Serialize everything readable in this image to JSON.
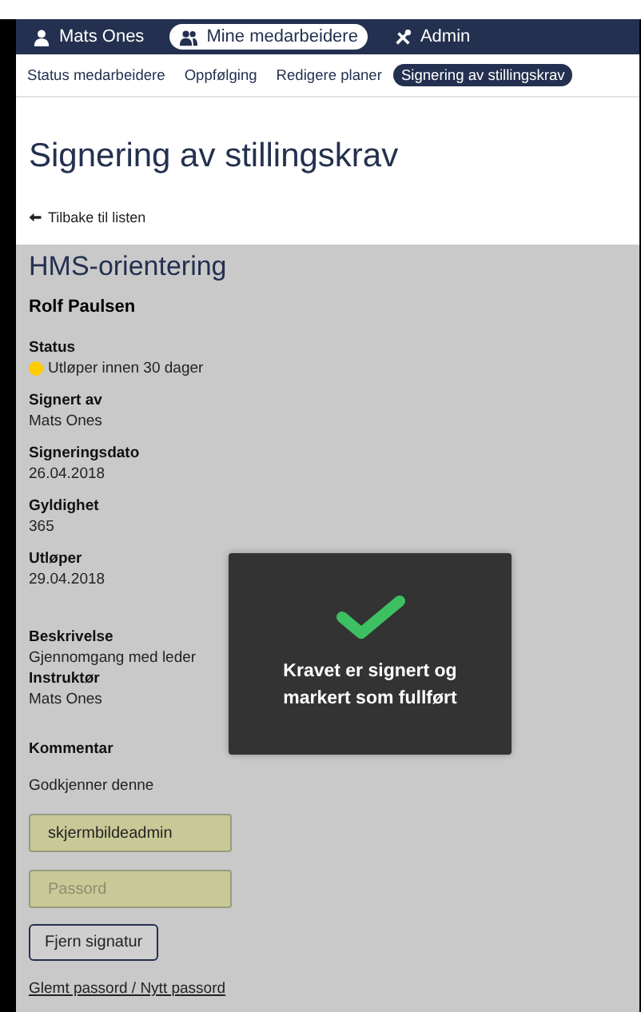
{
  "top_nav": [
    {
      "label": "Mats Ones",
      "kind": "person",
      "selected": false
    },
    {
      "label": "Mine medarbeidere",
      "kind": "people",
      "selected": true
    },
    {
      "label": "Admin",
      "kind": "tools",
      "selected": false
    }
  ],
  "sub_nav": [
    {
      "label": "Status medarbeidere",
      "selected": false
    },
    {
      "label": "Oppfølging",
      "selected": false
    },
    {
      "label": "Redigere planer",
      "selected": false
    },
    {
      "label": "Signering av stillingskrav",
      "selected": true
    }
  ],
  "page_title": "Signering av stillingskrav",
  "back_link": "Tilbake til listen",
  "requirement": {
    "title": "HMS-orientering",
    "employee": "Rolf Paulsen",
    "status": {
      "label": "Status",
      "value": "Utløper innen 30 dager",
      "color": "#ffcc00"
    },
    "fields": [
      {
        "label": "Signert av",
        "value": "Mats Ones"
      },
      {
        "label": "Signeringsdato",
        "value": "26.04.2018"
      },
      {
        "label": "Gyldighet",
        "value": "365"
      },
      {
        "label": "Utløper",
        "value": "29.04.2018"
      }
    ],
    "details": [
      {
        "label": "Beskrivelse",
        "value": "Gjennomgang med leder"
      },
      {
        "label": "Instruktør",
        "value": "Mats Ones"
      }
    ],
    "comment_label": "Kommentar",
    "comment": "Godkjenner denne"
  },
  "form": {
    "username": "skjermbildeadmin",
    "password_placeholder": "Passord",
    "button": "Fjern signatur",
    "forgot_link": "Glemt passord / Nytt passord"
  },
  "toast": {
    "message": "Kravet er signert og markert som fullført"
  }
}
